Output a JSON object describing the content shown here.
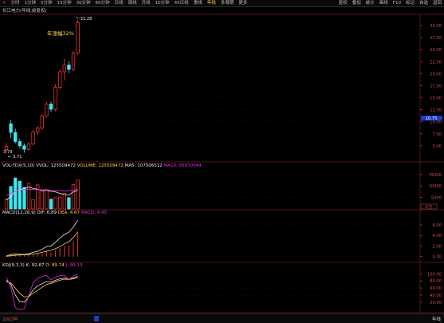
{
  "toolbar": {
    "close_symbol": "✕",
    "left": [
      "分时",
      "1分钟",
      "5分钟",
      "15分钟",
      "30分钟",
      "60分钟",
      "日线",
      "周线",
      "月线",
      "10分钟",
      "45日线",
      "季线",
      "年线",
      "多周期",
      "更多"
    ],
    "active_index": 12,
    "right": [
      "复权",
      "叠加",
      "统计",
      "画线",
      "F10",
      "标记",
      "自选",
      "返回"
    ]
  },
  "title": "长江电力(年线,前复权)",
  "price_panel": {
    "annotation": "年涨幅32%",
    "high_label": "31.28",
    "low_label": "3.71",
    "low_marker": "3.79",
    "current_price": "10.75",
    "axis": [
      "30.00",
      "27.50",
      "25.00",
      "22.50",
      "20.00",
      "17.50",
      "15.00",
      "12.50",
      "10.00",
      "7.50",
      "5.00"
    ]
  },
  "volume_panel": {
    "label_prefix": "VOL-TDX(5,10)",
    "vvol": "VVOL: 125509472",
    "volume": "VOLUME: 125509472",
    "ma5": "MA5: 107506512",
    "ma10": "MA10: 85970944",
    "axis": [
      "15000",
      "10000",
      "5000"
    ],
    "unit": "X万"
  },
  "macd_panel": {
    "label_prefix": "MACD(12,26,9)",
    "dif": "DIF: 6.89",
    "dea": "DEA: 4.67",
    "macd": "MACD: 4.45",
    "axis": [
      "6.00",
      "4.00",
      "2.00",
      "0.00"
    ]
  },
  "kdj_panel": {
    "label_prefix": "KDJ(9,3,3)",
    "k": "K: 92.87",
    "d": "D: 89.74",
    "j": "J: 99.13",
    "axis": [
      "100.00",
      "80.00",
      "60.00",
      "40.00",
      "20.00"
    ]
  },
  "bottom": {
    "year_label": "2003年",
    "right_label": "年线"
  },
  "colors": {
    "up": "#ff3b3b",
    "down": "#3ee6ee",
    "axis": "#d24b4b",
    "yellow": "#ffd24a",
    "magenta": "#e02be0",
    "white": "#e8e8e8"
  },
  "chart_data": {
    "type": "candlestick",
    "price_range": [
      2.5,
      32
    ],
    "candles": [
      {
        "o": 4.2,
        "h": 5.6,
        "l": 3.71,
        "c": 4.9
      },
      {
        "o": 9.6,
        "h": 10.4,
        "l": 6.6,
        "c": 7.8
      },
      {
        "o": 7.8,
        "h": 8.6,
        "l": 5.5,
        "c": 5.9
      },
      {
        "o": 5.9,
        "h": 6.5,
        "l": 4.5,
        "c": 5.0
      },
      {
        "o": 5.0,
        "h": 5.5,
        "l": 3.6,
        "c": 4.3
      },
      {
        "o": 4.3,
        "h": 5.8,
        "l": 4.0,
        "c": 5.4
      },
      {
        "o": 5.4,
        "h": 8.2,
        "l": 5.2,
        "c": 7.9
      },
      {
        "o": 7.9,
        "h": 9.1,
        "l": 7.2,
        "c": 8.7
      },
      {
        "o": 8.7,
        "h": 11.6,
        "l": 8.4,
        "c": 11.2
      },
      {
        "o": 11.2,
        "h": 14.1,
        "l": 10.9,
        "c": 13.7
      },
      {
        "o": 13.7,
        "h": 14.2,
        "l": 12.0,
        "c": 12.6
      },
      {
        "o": 12.6,
        "h": 17.8,
        "l": 12.2,
        "c": 17.2
      },
      {
        "o": 17.2,
        "h": 20.9,
        "l": 16.8,
        "c": 20.4
      },
      {
        "o": 20.4,
        "h": 23.1,
        "l": 18.6,
        "c": 21.8
      },
      {
        "o": 21.8,
        "h": 22.6,
        "l": 20.1,
        "c": 20.9
      },
      {
        "o": 20.9,
        "h": 24.8,
        "l": 20.5,
        "c": 24.3
      },
      {
        "o": 24.3,
        "h": 31.28,
        "l": 23.9,
        "c": 30.6
      }
    ],
    "volume": {
      "range": [
        0,
        17000
      ],
      "bars": [
        4200,
        9800,
        13500,
        12100,
        9400,
        11200,
        4100,
        10500,
        8300,
        8600,
        4300,
        4900,
        5200,
        6800,
        4900,
        10600,
        12550
      ]
    },
    "vol_ma5": [
      3800,
      5600,
      7600,
      8400,
      8800,
      9600,
      8900,
      8600,
      7900,
      8100,
      7700,
      7400,
      6700,
      6300,
      6100,
      7400,
      8100
    ],
    "vol_ma10": [
      6000,
      6800,
      7600,
      8100,
      8500,
      8600,
      8500,
      8400,
      8300,
      8200,
      8100,
      8050,
      8000,
      7850,
      7950,
      8200,
      8600
    ],
    "macd": {
      "range": [
        -0.8,
        7.5
      ],
      "hist": [
        0.15,
        0.3,
        0.35,
        0.3,
        0.25,
        0.3,
        0.45,
        0.5,
        0.7,
        0.9,
        0.8,
        1.2,
        1.6,
        2.0,
        2.1,
        2.8,
        4.45
      ],
      "dif": [
        0.1,
        0.4,
        0.5,
        0.45,
        0.4,
        0.55,
        0.8,
        1.0,
        1.4,
        1.9,
        2.0,
        2.7,
        3.5,
        4.2,
        4.6,
        5.6,
        6.89
      ],
      "dea": [
        0.05,
        0.15,
        0.25,
        0.3,
        0.33,
        0.38,
        0.48,
        0.6,
        0.8,
        1.0,
        1.2,
        1.5,
        1.9,
        2.4,
        2.8,
        3.6,
        4.67
      ]
    },
    "kdj": {
      "range": [
        -5,
        112
      ],
      "k": [
        82,
        70,
        40,
        22,
        20,
        35,
        55,
        66,
        72,
        78,
        76,
        82,
        86,
        88,
        84,
        88,
        92.87
      ],
      "d": [
        78,
        74,
        60,
        45,
        35,
        36,
        45,
        54,
        62,
        70,
        73,
        78,
        82,
        85,
        84,
        86,
        89.74
      ],
      "j": [
        90,
        62,
        5,
        -2,
        2,
        38,
        75,
        88,
        92,
        96,
        83,
        90,
        95,
        96,
        84,
        94,
        99.13
      ]
    }
  }
}
